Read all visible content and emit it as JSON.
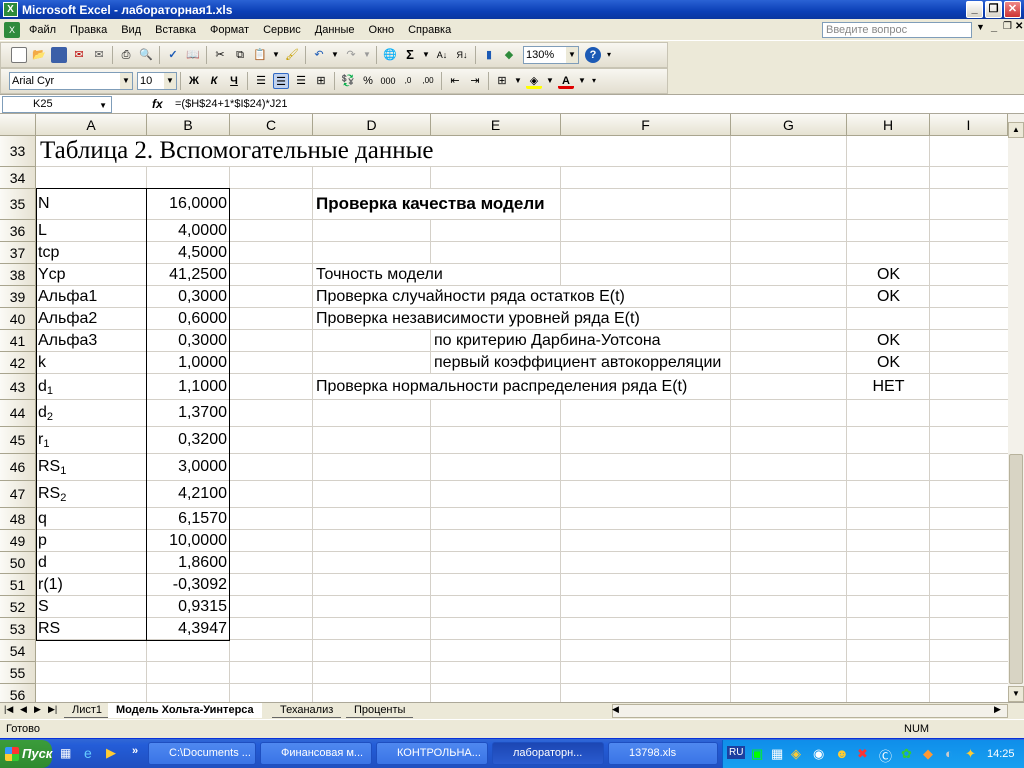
{
  "window": {
    "title": "Microsoft Excel - лабораторная1.xls",
    "app_icon": "excel-icon"
  },
  "menu": {
    "items": [
      "Файл",
      "Правка",
      "Вид",
      "Вставка",
      "Формат",
      "Сервис",
      "Данные",
      "Окно",
      "Справка"
    ],
    "ask_placeholder": "Введите вопрос"
  },
  "toolbar": {
    "zoom": "130%",
    "font_name": "Arial Cyr",
    "font_size": "10"
  },
  "formula_bar": {
    "name_box": "K25",
    "fx": "fx",
    "formula": "=($H$24+1*$I$24)*J21"
  },
  "columns": [
    "A",
    "B",
    "C",
    "D",
    "E",
    "F",
    "G",
    "H",
    "I"
  ],
  "rows": [
    "33",
    "34",
    "35",
    "36",
    "37",
    "38",
    "39",
    "40",
    "41",
    "42",
    "43",
    "44",
    "45",
    "46",
    "47",
    "48",
    "49",
    "50",
    "51",
    "52",
    "53",
    "54",
    "55",
    "56"
  ],
  "sheet_title": "Таблица 2. Вспомогательные данные",
  "params": [
    {
      "label": "N",
      "sub": "",
      "value": "16,0000"
    },
    {
      "label": "L",
      "sub": "",
      "value": "4,0000"
    },
    {
      "label": "tср",
      "sub": "",
      "value": "4,5000"
    },
    {
      "label": "Yср",
      "sub": "",
      "value": "41,2500"
    },
    {
      "label": "Альфа1",
      "sub": "",
      "value": "0,3000"
    },
    {
      "label": "Альфа2",
      "sub": "",
      "value": "0,6000"
    },
    {
      "label": "Альфа3",
      "sub": "",
      "value": "0,3000"
    },
    {
      "label": "k",
      "sub": "",
      "value": "1,0000"
    },
    {
      "label": "d",
      "sub": "1",
      "value": "1,1000"
    },
    {
      "label": "d",
      "sub": "2",
      "value": "1,3700"
    },
    {
      "label": "r",
      "sub": "1",
      "value": "0,3200"
    },
    {
      "label": "RS",
      "sub": "1",
      "value": "3,0000"
    },
    {
      "label": "RS",
      "sub": "2",
      "value": "4,2100"
    },
    {
      "label": "q",
      "sub": "",
      "value": "6,1570"
    },
    {
      "label": "p",
      "sub": "",
      "value": "10,0000"
    },
    {
      "label": "d",
      "sub": "",
      "value": "1,8600"
    },
    {
      "label": "r(1)",
      "sub": "",
      "value": "-0,3092"
    },
    {
      "label": "S",
      "sub": "",
      "value": "0,9315"
    },
    {
      "label": "RS",
      "sub": "",
      "value": "4,3947"
    }
  ],
  "quality": {
    "header": "Проверка качества модели",
    "accuracy": "Точность модели",
    "accuracy_result": "OK",
    "randomness": "Проверка случайности ряда остатков E(t)",
    "randomness_result": "OK",
    "independence": "Проверка независимости уровней ряда E(t)",
    "dw": "по критерию Дарбина-Уотсона",
    "dw_result": "OK",
    "autocorr": "первый коэффициент автокорреляции",
    "autocorr_result": "OK",
    "normality": "Проверка нормальности распределения ряда E(t)",
    "normality_result": "НЕТ"
  },
  "sheets": [
    "Лист1",
    "Модель Хольта-Уинтерса",
    "Теханализ",
    "Проценты"
  ],
  "status": {
    "ready": "Готово",
    "num": "NUM"
  },
  "taskbar": {
    "start": "Пуск",
    "tasks": [
      "C:\\Documents ...",
      "Финансовая м...",
      "КОНТРОЛЬНА...",
      "лабораторн...",
      "13798.xls"
    ],
    "lang": "RU",
    "clock": "14:25"
  }
}
